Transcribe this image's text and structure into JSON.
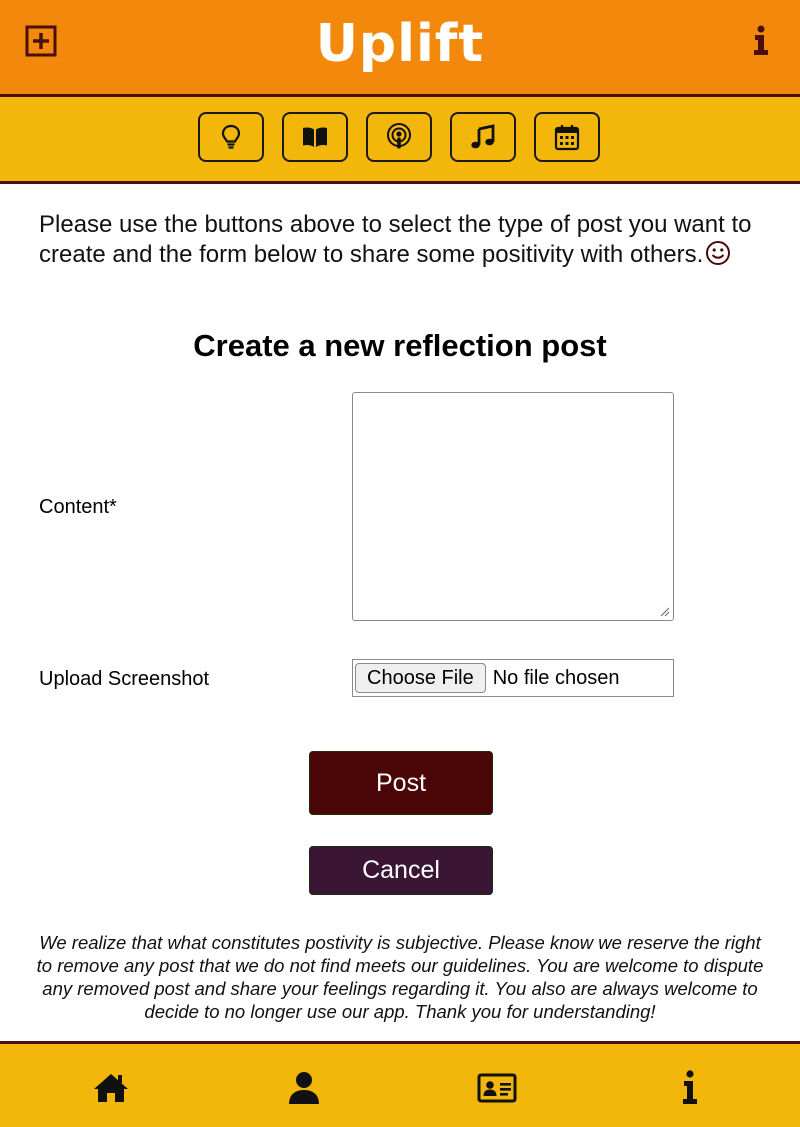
{
  "header": {
    "brand": "Uplift",
    "icons": {
      "left": "plus-square-icon",
      "right": "info-icon"
    }
  },
  "post_types": [
    {
      "icon": "lightbulb-icon"
    },
    {
      "icon": "book-icon"
    },
    {
      "icon": "podcast-icon"
    },
    {
      "icon": "music-note-icon"
    },
    {
      "icon": "calendar-icon"
    }
  ],
  "intro": {
    "text": "Please use the buttons above to select the type of post you want to create and the form below to share some positivity with others.",
    "emoji": "smiley-icon"
  },
  "form": {
    "title": "Create a new reflection post",
    "content_label": "Content*",
    "content_value": "",
    "upload_label": "Upload Screenshot",
    "choose_file_label": "Choose File",
    "no_file_text": "No file chosen"
  },
  "actions": {
    "post_label": "Post",
    "cancel_label": "Cancel"
  },
  "disclaimer": "We realize that what constitutes postivity is subjective. Please know we reserve the right to remove any post that we do not find meets our guidelines. You are welcome to dispute any removed post and share your feelings regarding it. You also are always welcome to decide to no longer use our app. Thank you for understanding!",
  "bottom_nav": [
    {
      "icon": "home-icon"
    },
    {
      "icon": "user-icon"
    },
    {
      "icon": "id-card-icon"
    },
    {
      "icon": "info-icon"
    }
  ],
  "colors": {
    "header_bg": "#f2890c",
    "bar_bg": "#f2b70a",
    "accent_dark": "#4a1010",
    "post_button": "#4a0606",
    "cancel_button": "#3a1634"
  }
}
